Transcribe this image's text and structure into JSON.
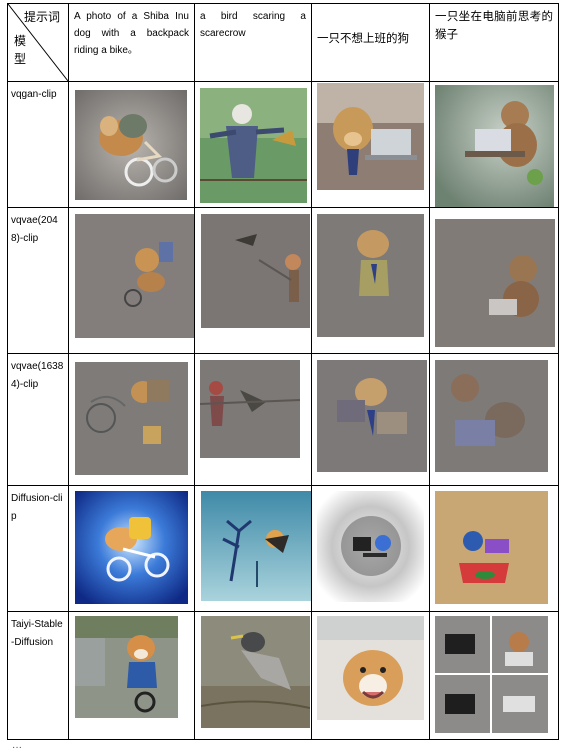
{
  "table": {
    "corner_prompt_label": "提示词",
    "corner_model_label": "模型",
    "prompts": [
      "A photo of a Shiba Inu dog with a backpack riding a bike。",
      "a bird scaring a scarecrow",
      "一只不想上班的狗",
      "一只坐在电脑前思考的猴子"
    ],
    "models": [
      "vqgan-clip",
      "vqvae(2048)-clip",
      "vqvae(16384)-clip",
      "Diffusion-clip",
      "Taiyi-Stable-Diffusion"
    ],
    "images": [
      [
        "shiba-bike-image",
        "bird-scarecrow-image",
        "dog-office-image",
        "monkey-computer-image"
      ],
      [
        "shiba-bike-image",
        "bird-scarecrow-image",
        "dog-office-image",
        "monkey-computer-image"
      ],
      [
        "shiba-bike-image",
        "bird-scarecrow-image",
        "dog-office-image",
        "monkey-computer-image"
      ],
      [
        "shiba-bike-image",
        "bird-scarecrow-image",
        "dog-office-image",
        "monkey-computer-image"
      ],
      [
        "shiba-bike-image",
        "bird-scarecrow-image",
        "dog-office-image",
        "monkey-computer-image"
      ]
    ]
  },
  "trailing_text": "···"
}
